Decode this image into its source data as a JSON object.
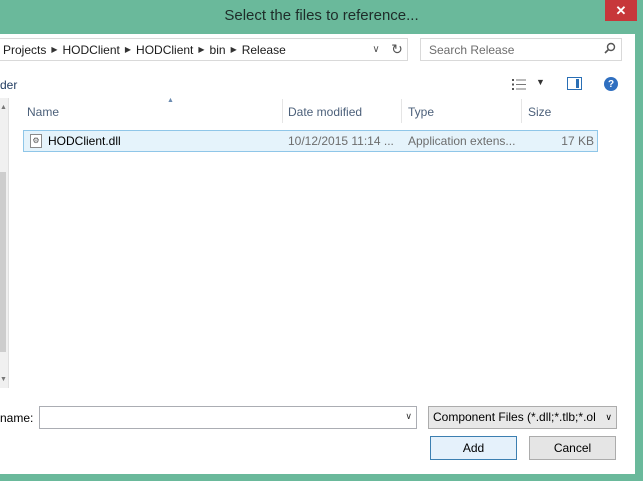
{
  "window": {
    "title": "Select the files to reference...",
    "close_glyph": "✕"
  },
  "address_bar": {
    "crumbs": [
      "Projects",
      "HODClient",
      "HODClient",
      "bin",
      "Release"
    ],
    "separator": "▶",
    "dropdown_glyph": "∨",
    "refresh_glyph": "↻"
  },
  "search": {
    "placeholder": "Search Release",
    "icon": "search-icon"
  },
  "toolbar": {
    "partial_label": "der",
    "view_dropdown_glyph": "▼",
    "help_glyph": "?"
  },
  "columns": [
    {
      "label": "Name"
    },
    {
      "label": "Date modified"
    },
    {
      "label": "Type"
    },
    {
      "label": "Size"
    }
  ],
  "files": [
    {
      "name": "HODClient.dll",
      "date_modified": "10/12/2015 11:14 ...",
      "type": "Application extens...",
      "size": "17 KB",
      "selected": true
    }
  ],
  "bottom": {
    "filename_label": "name:",
    "filename_value": "",
    "filter_value": "Component Files (*.dll;*.tlb;*.ol",
    "dropdown_glyph": "∨",
    "add_label": "Add",
    "cancel_label": "Cancel"
  },
  "colors": {
    "frame": "#6ab99b",
    "close": "#c7373a",
    "selection": "#e5f3fb",
    "header_text": "#4c607a"
  }
}
